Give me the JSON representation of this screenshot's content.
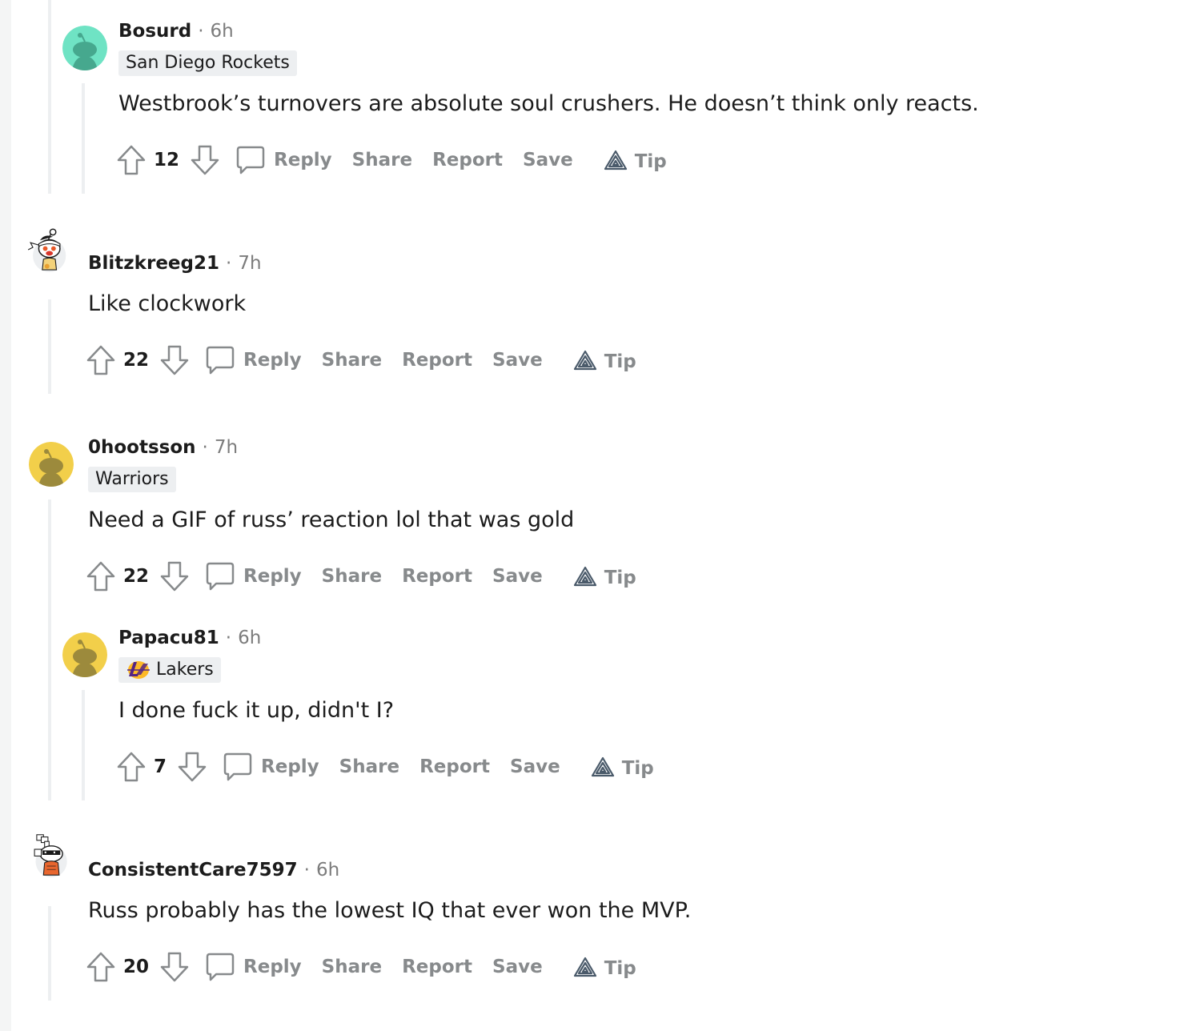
{
  "colors": {
    "text": "#1c1c1c",
    "muted": "#7c7c7c",
    "action": "#878a8c",
    "flair_bg": "#edeff1",
    "thread_line": "#edeff1",
    "avatar_teal": "#6fe3c4",
    "avatar_yellow": "#f2cf4a"
  },
  "comments": [
    {
      "author": "Bosurd",
      "separator": "·",
      "time": "6h",
      "flair": "San Diego Rockets",
      "text": "Westbrook’s turnovers are absolute soul crushers. He doesn’t think only reacts.",
      "score": "12",
      "avatar_icon": "default-snoo-teal-icon"
    },
    {
      "author": "Blitzkreeg21",
      "separator": "·",
      "time": "7h",
      "flair": "",
      "text": "Like clockwork",
      "score": "22",
      "avatar_icon": "custom-snoo-headband-icon"
    },
    {
      "author": "0hootsson",
      "separator": "·",
      "time": "7h",
      "flair": "Warriors",
      "text": "Need a GIF of russ’ reaction lol that was gold",
      "score": "22",
      "avatar_icon": "default-snoo-yellow-icon"
    },
    {
      "author": "Papacu81",
      "separator": "·",
      "time": "6h",
      "flair": "Lakers",
      "flair_icon": "lakers-logo-icon",
      "text": "I done fuck it up, didn't I?",
      "score": "7",
      "avatar_icon": "default-snoo-yellow-icon"
    },
    {
      "author": "ConsistentCare7597",
      "separator": "·",
      "time": "6h",
      "flair": "",
      "text": "Russ probably has the lowest IQ that ever won the MVP.",
      "score": "20",
      "avatar_icon": "custom-snoo-sunglasses-icon"
    }
  ],
  "actions": {
    "reply": "Reply",
    "share": "Share",
    "report": "Report",
    "save": "Save",
    "tip": "Tip"
  }
}
